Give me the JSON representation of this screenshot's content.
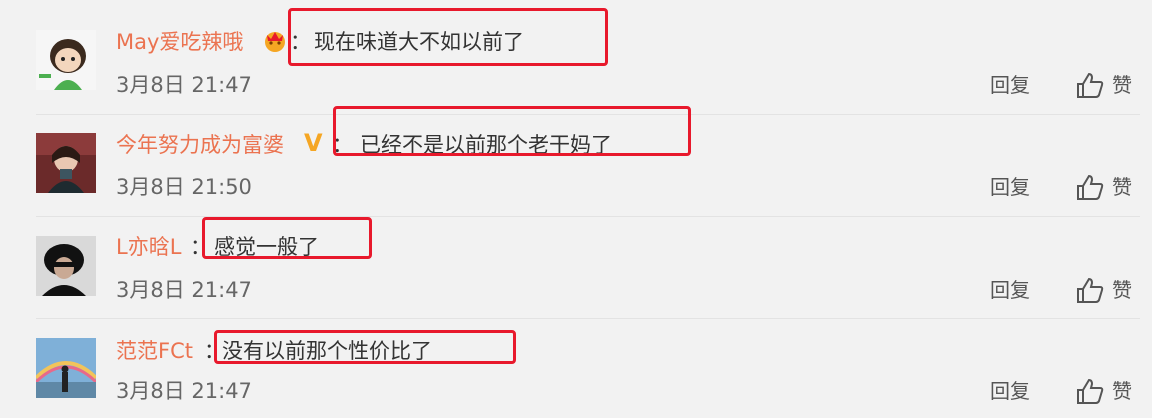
{
  "comments": [
    {
      "username": "May爱吃辣哦",
      "badge": "crown-icon",
      "colon": "：",
      "text": "现在味道大不如以前了",
      "time": "3月8日 21:47",
      "reply": "回复",
      "like": "赞"
    },
    {
      "username": "今年努力成为富婆",
      "badge": "V",
      "colon": "：",
      "text": "已经不是以前那个老干妈了",
      "time": "3月8日 21:50",
      "reply": "回复",
      "like": "赞"
    },
    {
      "username": "L亦晗L",
      "colon": "：",
      "text": "感觉一般了",
      "time": "3月8日 21:47",
      "reply": "回复",
      "like": "赞"
    },
    {
      "username": "范范FCt",
      "colon": "：",
      "text": "没有以前那个性价比了",
      "time": "3月8日 21:47",
      "reply": "回复",
      "like": "赞"
    }
  ],
  "colors": {
    "username": "#eb7350",
    "highlight": "#e8192c",
    "background": "#f2f2f2"
  }
}
